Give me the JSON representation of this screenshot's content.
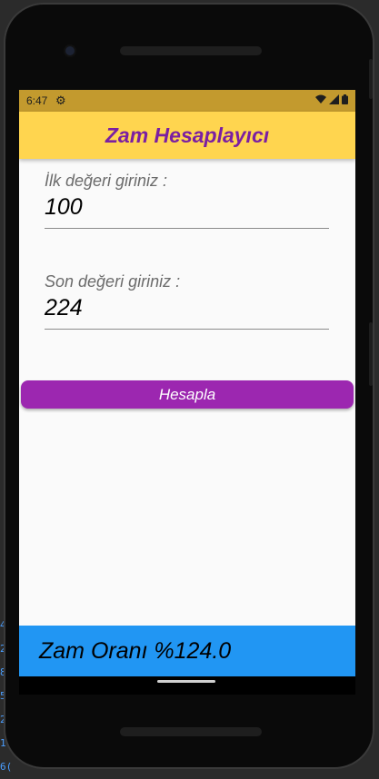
{
  "status_bar": {
    "time": "6:47",
    "settings_icon": "gear-icon",
    "wifi_icon": "wifi-icon",
    "signal_icon": "signal-icon",
    "battery_icon": "battery-icon"
  },
  "app_bar": {
    "title": "Zam Hesaplayıcı",
    "background": "#ffd54f",
    "title_color": "#7b1fa2"
  },
  "form": {
    "first": {
      "label": "İlk değeri giriniz :",
      "value": "100"
    },
    "second": {
      "label": "Son değeri giriniz :",
      "value": "224"
    },
    "calculate_button": {
      "label": "Hesapla",
      "color": "#9c27b0"
    }
  },
  "result": {
    "text": "Zam Oranı %124.0",
    "background": "#2196f3"
  },
  "ide_gutter": [
    "4",
    "2",
    "8",
    "5",
    "2",
    "1",
    "6("
  ]
}
